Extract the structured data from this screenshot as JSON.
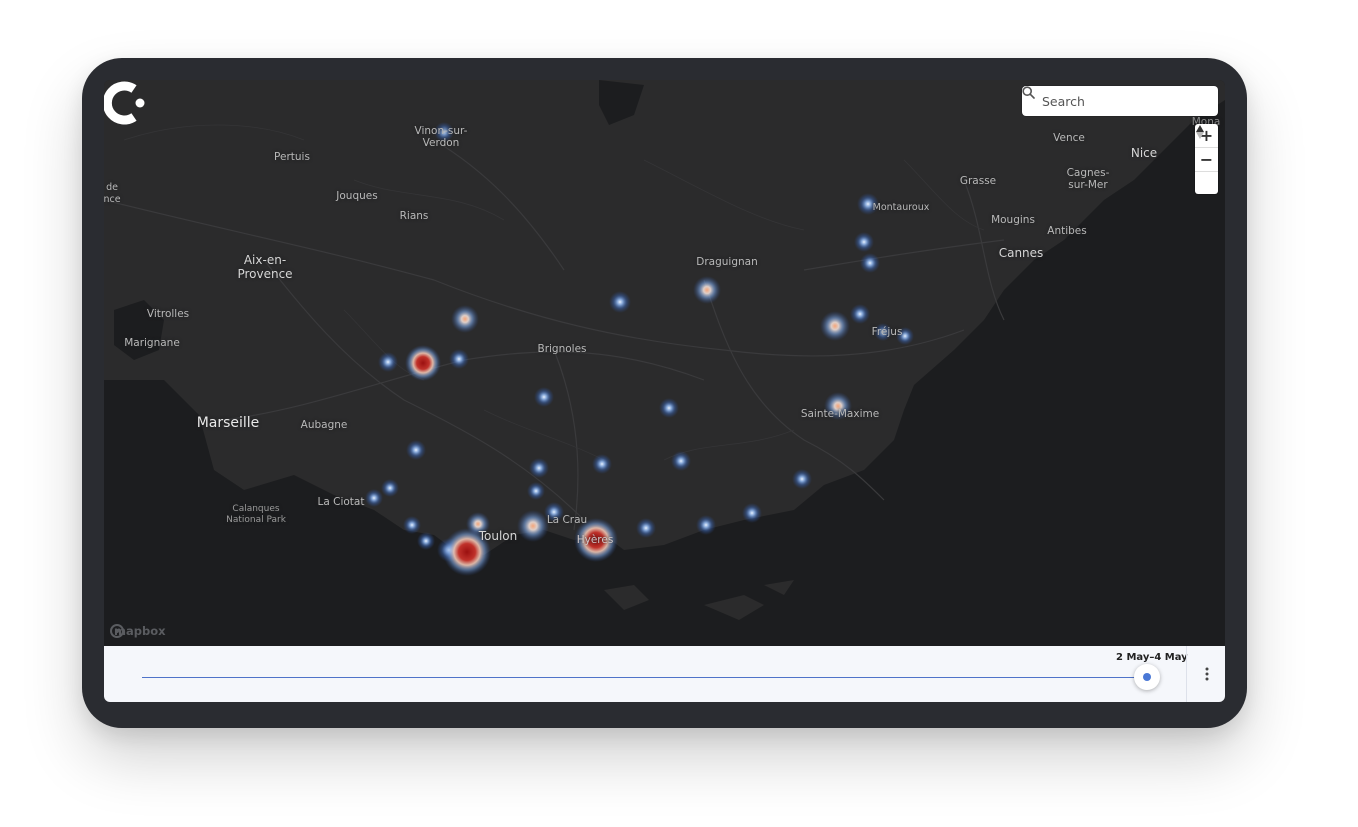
{
  "app": {
    "logo_icon": "c-logo-icon"
  },
  "search": {
    "placeholder": "Search",
    "icon": "search-icon"
  },
  "nav_controls": {
    "zoom_in": "+",
    "zoom_out": "−",
    "compass": "▲"
  },
  "attribution": {
    "text": "mapbox"
  },
  "map_labels": {
    "vinon": "Vinon-sur-\nVerdon",
    "pertuis": "Pertuis",
    "jouques": "Jouques",
    "rians": "Rians",
    "aix": "Aix-en-\nProvence",
    "vitrolles": "Vitrolles",
    "marignane": "Marignane",
    "marseille": "Marseille",
    "aubagne": "Aubagne",
    "laciotat": "La Ciotat",
    "calanques": "Calanques\nNational Park",
    "toulon": "Toulon",
    "lacrau": "La Crau",
    "hyeres": "Hyères",
    "brignoles": "Brignoles",
    "draguignan": "Draguignan",
    "montauroux": "Montauroux",
    "frejus": "Fréjus",
    "saintemaxime": "Sainte-Maxime",
    "grasse": "Grasse",
    "mougins": "Mougins",
    "cannes": "Cannes",
    "antibes": "Antibes",
    "vence": "Vence",
    "cagnes": "Cagnes-\nsur-Mer",
    "nice": "Nice",
    "monaco": "Mona",
    "de": "de\nnce"
  },
  "timeline": {
    "range_label": "2 May–4 May",
    "position": 1.0,
    "more_icon": "more-vertical-icon"
  },
  "heat_points": [
    {
      "name": "Vinon-sur-Verdon",
      "intensity": 0.25
    },
    {
      "name": "Montauroux",
      "intensity": 0.25
    },
    {
      "name": "Draguignan",
      "intensity": 0.55
    },
    {
      "name": "Toulon",
      "intensity": 1.0
    },
    {
      "name": "Hyères",
      "intensity": 1.0
    }
  ]
}
